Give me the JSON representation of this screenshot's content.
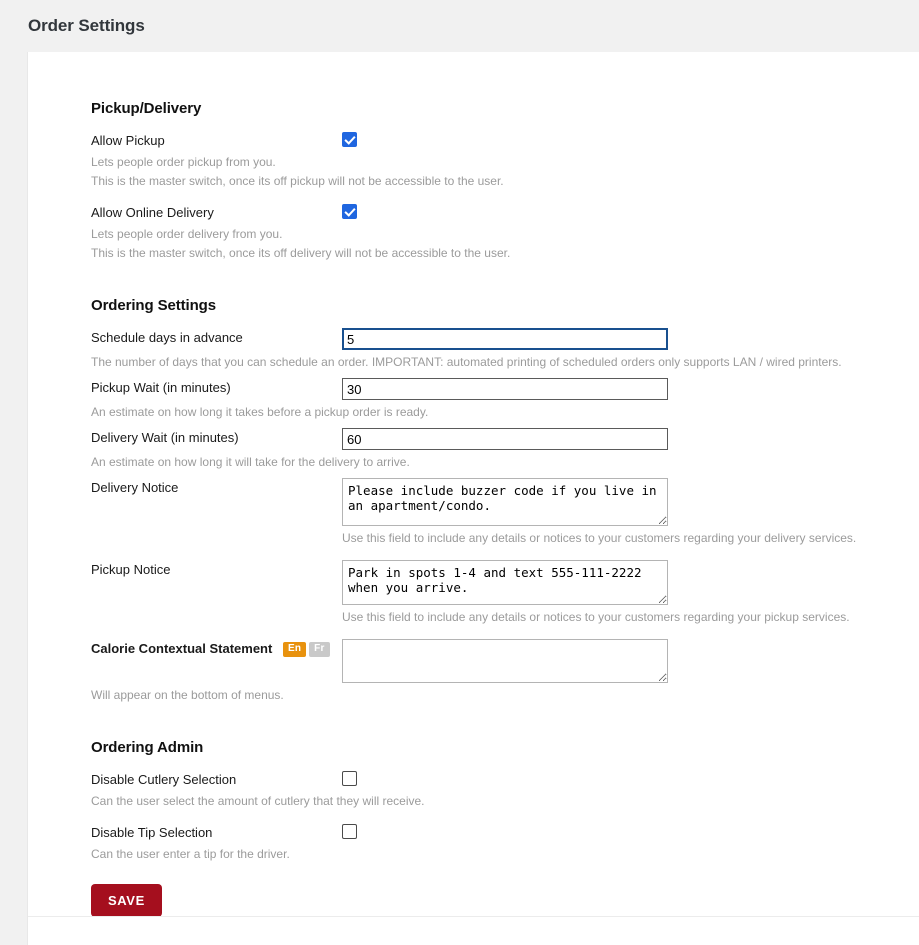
{
  "header": {
    "title": "Order Settings"
  },
  "sections": {
    "pickup_delivery": {
      "title": "Pickup/Delivery",
      "allow_pickup": {
        "label": "Allow Pickup",
        "checked": true,
        "help1": "Lets people order pickup from you.",
        "help2": "This is the master switch, once its off pickup will not be accessible to the user."
      },
      "allow_online_delivery": {
        "label": "Allow Online Delivery",
        "checked": true,
        "help1": "Lets people order delivery from you.",
        "help2": "This is the master switch, once its off delivery will not be accessible to the user."
      }
    },
    "ordering_settings": {
      "title": "Ordering Settings",
      "schedule_days": {
        "label": "Schedule days in advance",
        "value": "5",
        "help": "The number of days that you can schedule an order. IMPORTANT: automated printing of scheduled orders only supports LAN / wired printers."
      },
      "pickup_wait": {
        "label": "Pickup Wait (in minutes)",
        "value": "30",
        "help": "An estimate on how long it takes before a pickup order is ready."
      },
      "delivery_wait": {
        "label": "Delivery Wait (in minutes)",
        "value": "60",
        "help": "An estimate on how long it will take for the delivery to arrive."
      },
      "delivery_notice": {
        "label": "Delivery Notice",
        "value": "Please include buzzer code if you live in an apartment/condo.",
        "help": "Use this field to include any details or notices to your customers regarding your delivery services."
      },
      "pickup_notice": {
        "label": "Pickup Notice",
        "value": "Park in spots 1-4 and text 555-111-2222 when you arrive.",
        "help": "Use this field to include any details or notices to your customers regarding your pickup services."
      },
      "calorie_statement": {
        "label": "Calorie Contextual Statement",
        "value": "",
        "help": "Will appear on the bottom of menus.",
        "lang_active": "En",
        "lang_inactive": "Fr"
      }
    },
    "ordering_admin": {
      "title": "Ordering Admin",
      "disable_cutlery": {
        "label": "Disable Cutlery Selection",
        "checked": false,
        "help": "Can the user select the amount of cutlery that they will receive."
      },
      "disable_tip": {
        "label": "Disable Tip Selection",
        "checked": false,
        "help": "Can the user enter a tip for the driver."
      }
    }
  },
  "actions": {
    "save_label": "SAVE"
  },
  "colors": {
    "accent_checkbox": "#1f66e0",
    "save_button": "#a50f1e",
    "badge_active": "#e8920e",
    "badge_inactive": "#c9c9c9",
    "focus_border": "#19508f"
  }
}
